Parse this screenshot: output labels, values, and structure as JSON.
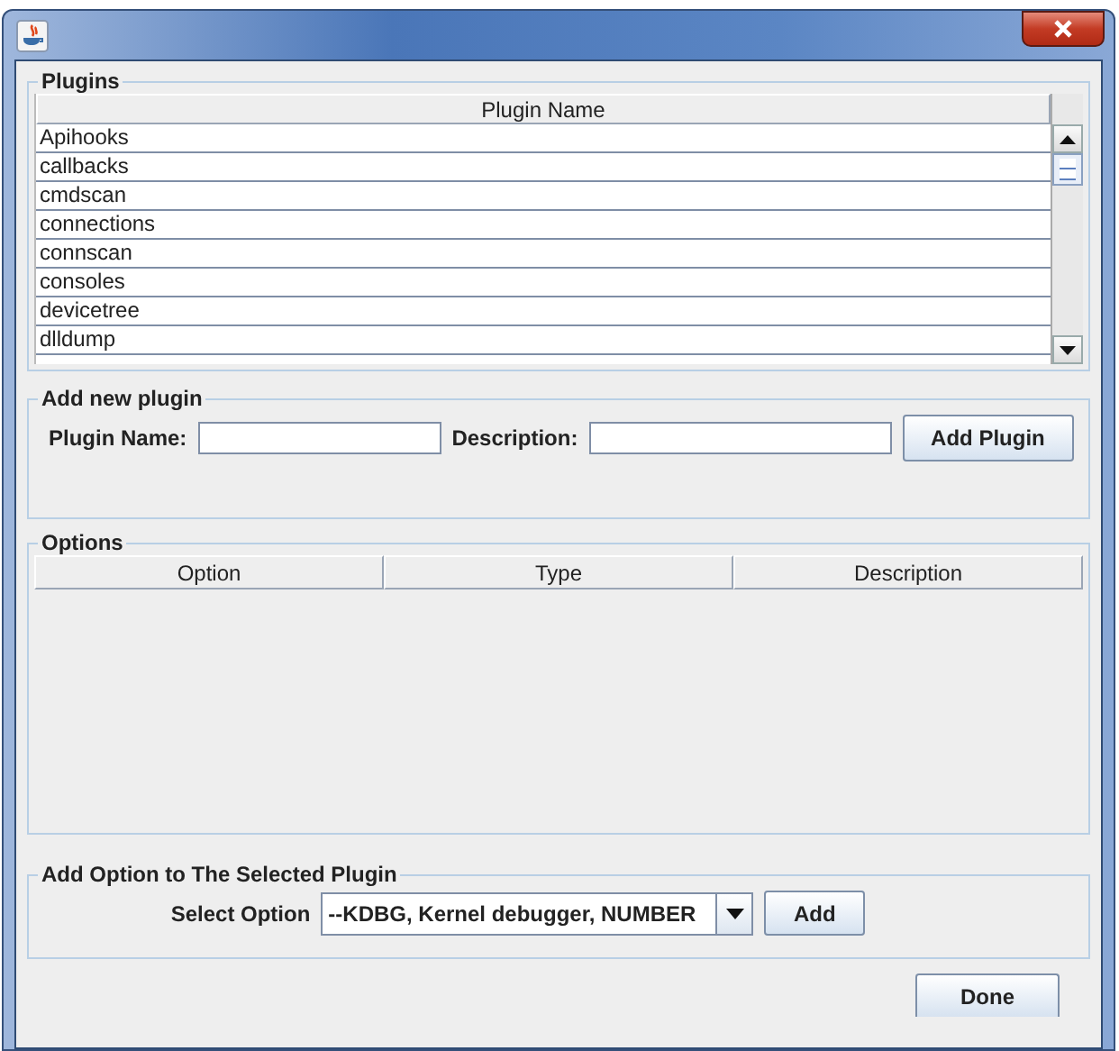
{
  "plugins": {
    "title": "Plugins",
    "column": "Plugin Name",
    "rows": [
      "Apihooks",
      "callbacks",
      "cmdscan",
      "connections",
      "connscan",
      "consoles",
      "devicetree",
      "dlldump"
    ]
  },
  "add_plugin": {
    "title": "Add new plugin",
    "name_label": "Plugin Name:",
    "description_label": "Description:",
    "button": "Add Plugin"
  },
  "options": {
    "title": "Options",
    "columns": [
      "Option",
      "Type",
      "Description"
    ]
  },
  "add_option": {
    "title": "Add Option to The Selected Plugin",
    "label": "Select Option",
    "value": "--KDBG, Kernel debugger, NUMBER",
    "button": "Add"
  },
  "done_button": "Done"
}
